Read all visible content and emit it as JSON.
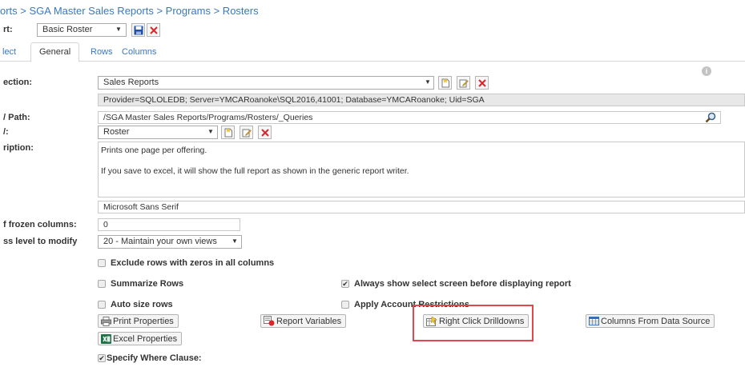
{
  "breadcrumb": "orts > SGA Master Sales Reports > Programs > Rosters",
  "report": {
    "label": "rt:",
    "selected": "Basic Roster"
  },
  "tabs": [
    {
      "label": "lect"
    },
    {
      "label": "General"
    },
    {
      "label": "Rows"
    },
    {
      "label": "Columns"
    }
  ],
  "connection": {
    "label": "ection:",
    "selected": "Sales Reports",
    "connection_string": "Provider=SQLOLEDB; Server=YMCARoanoke\\SQL2016,41001; Database=YMCARoanoke; Uid=SGA"
  },
  "query_path": {
    "label": "/ Path:",
    "value": "/SGA Master Sales Reports/Programs/Rosters/_Queries"
  },
  "query": {
    "label": "/:",
    "selected": "Roster"
  },
  "description": {
    "label": "ription:",
    "line1": "Prints one page per offering.",
    "line2": "If you save to excel, it will show the full report as shown in the generic report writer."
  },
  "font": {
    "value": "Microsoft Sans Serif"
  },
  "frozen_columns": {
    "label": "f frozen columns:",
    "value": "0"
  },
  "access_level": {
    "label": "ss level to modify",
    "selected": "20 - Maintain your own views"
  },
  "options": {
    "exclude_zero_rows": {
      "label": "Exclude rows with zeros in all columns",
      "checked": false
    },
    "summarize_rows": {
      "label": "Summarize Rows",
      "checked": false
    },
    "always_show_select": {
      "label": "Always show select screen before displaying report",
      "checked": true
    },
    "auto_size_rows": {
      "label": "Auto size rows",
      "checked": false
    },
    "apply_account_restrictions": {
      "label": "Apply Account Restrictions",
      "checked": false
    },
    "specify_where_clause": {
      "label": "Specify Where Clause:",
      "checked": true
    }
  },
  "buttons": {
    "print_properties": "Print Properties",
    "report_variables": "Report Variables",
    "right_click_drilldowns": "Right Click Drilldowns",
    "columns_from_data_source": "Columns From Data Source",
    "excel_properties": "Excel Properties"
  },
  "glyphs": {
    "checkmark": "✔",
    "dropdown_arrow": "▼",
    "info": "i"
  },
  "colors": {
    "link": "#3a78bf",
    "highlight_border": "#e0484e",
    "delete_red": "#d9262c",
    "save_blue": "#1f4fa8"
  }
}
